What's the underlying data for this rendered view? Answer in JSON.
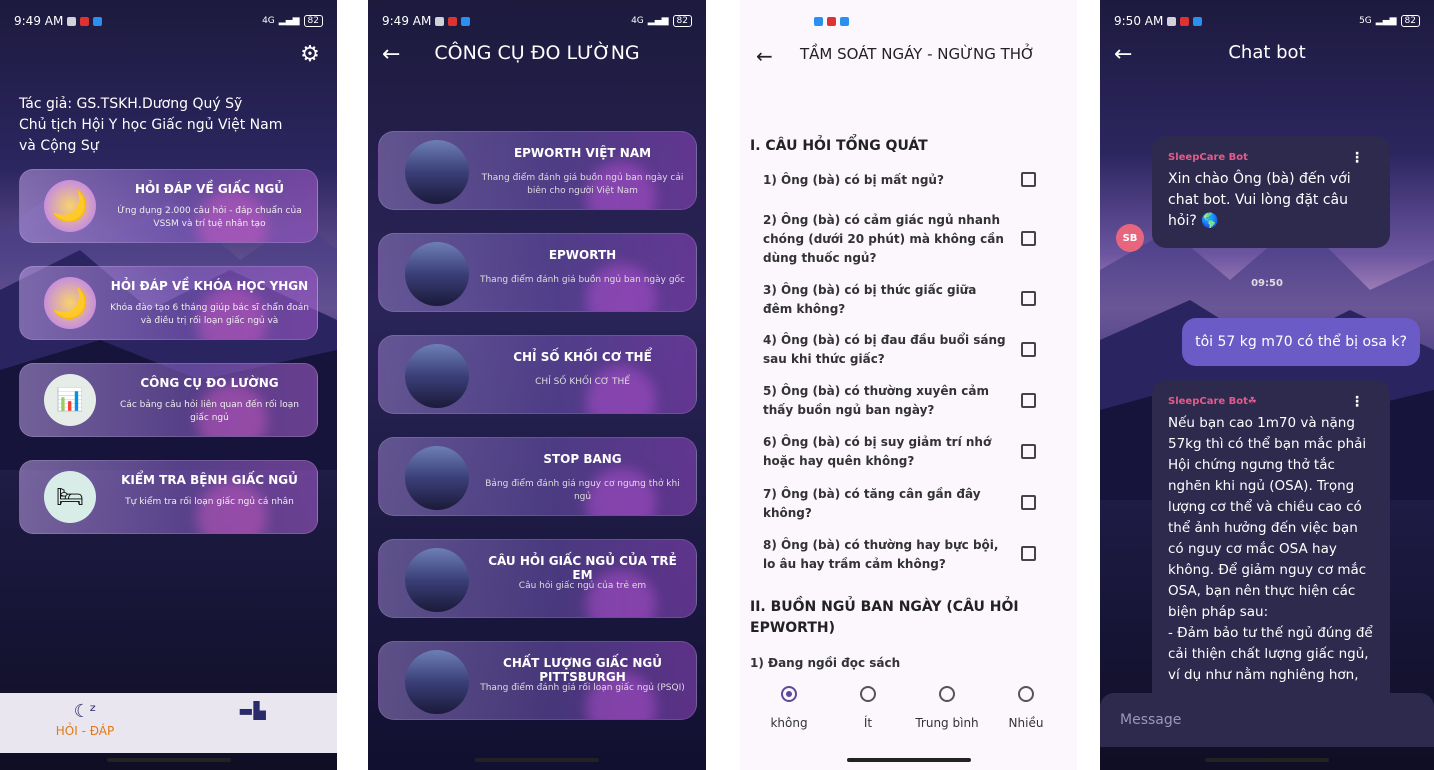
{
  "colors": {
    "bottom_nav_active": "#e07a18",
    "user_bubble": "#6b5bc6",
    "bot_bubble": "#2d2a4e",
    "bot_name": "#e45b8a",
    "avatar": "#e7667d"
  },
  "screen1": {
    "status": {
      "time": "9:49 AM",
      "signal": "4G",
      "battery": "82"
    },
    "settings_icon": "gear-icon",
    "author_lines": [
      "Tác giả: GS.TSKH.Dương Quý Sỹ",
      "Chủ tịch Hội Y học Giấc ngủ Việt Nam",
      "và Cộng Sự"
    ],
    "menu": [
      {
        "title": "HỎI ĐÁP VỀ GIẤC NGỦ",
        "subtitle": "Ứng dụng 2.000 câu hỏi - đáp chuẩn của VSSM và trí tuệ nhân tạo",
        "icon": "sleeping-moon-icon"
      },
      {
        "title": "HỎI ĐÁP VỀ KHÓA HỌC YHGN",
        "subtitle": "Khóa đào tạo 6 tháng giúp bác sĩ chẩn đoán và điều trị rối loạn giấc ngủ và",
        "icon": "sleeping-moon-icon"
      },
      {
        "title": "CÔNG CỤ ĐO LƯỜNG",
        "subtitle": "Các bảng câu hỏi liên quan đến rối loạn giấc ngủ",
        "icon": "measurement-tools-icon"
      },
      {
        "title": "KIỂM TRA BỆNH GIẤC NGỦ",
        "subtitle": "Tự kiểm tra rối loạn giấc ngủ cá nhân",
        "icon": "sleep-test-icon"
      }
    ],
    "nav": {
      "qa_label": "HỎI - ĐÁP",
      "qa_icon": "zzz-moon-icon",
      "bed_icon": "bed-icon"
    }
  },
  "screen2": {
    "status": {
      "time": "9:49 AM",
      "signal": "4G",
      "battery": "82"
    },
    "title": "CÔNG CỤ ĐO LƯỜNG",
    "tools": [
      {
        "title": "EPWORTH VIỆT NAM",
        "subtitle": "Thang điểm đánh giá buồn ngủ ban ngày cải biên cho người Việt Nam"
      },
      {
        "title": "EPWORTH",
        "subtitle": "Thang điểm đánh giá buồn ngủ ban ngày gốc"
      },
      {
        "title": "CHỈ SỐ KHỐI CƠ THỂ",
        "subtitle": "CHỈ SỐ KHỐI CƠ THỂ"
      },
      {
        "title": "STOP BANG",
        "subtitle": "Bảng điểm đánh giá nguy cơ ngưng thở khi ngủ"
      },
      {
        "title": "CÂU HỎI GIẤC NGỦ CỦA TRẺ EM",
        "subtitle": "Câu hỏi giấc ngủ của trẻ em"
      },
      {
        "title": "CHẤT LƯỢNG GIẤC NGỦ PITTSBURGH",
        "subtitle": "Thang điểm đánh giá rối loạn giấc ngủ (PSQI)"
      }
    ]
  },
  "screen3": {
    "title": "TẦM SOÁT NGÁY - NGỪNG THỞ",
    "section1": "I. CÂU HỎI TỔNG QUÁT",
    "questions": [
      "1) Ông (bà) có bị mất ngủ?",
      "2) Ông (bà) có cảm giác ngủ nhanh chóng (dưới 20 phút) mà không cần dùng thuốc ngủ?",
      "3) Ông (bà) có bị thức giấc giữa đêm không?",
      "4) Ông (bà) có bị đau đầu buổi sáng sau khi thức giấc?",
      "5) Ông (bà) có thường xuyên cảm thấy buồn ngủ ban ngày?",
      "6) Ông (bà) có bị suy giảm trí nhớ hoặc hay quên không?",
      "7) Ông (bà) có tăng cân gần đây không?",
      "8) Ông (bà) có thường hay bực bội, lo âu hay trầm cảm không?"
    ],
    "section2": "II. BUỒN NGỦ BAN NGÀY (CÂU HỎI EPWORTH)",
    "epworth_q1": "1) Đang ngồi đọc sách",
    "options": [
      "không",
      "Ít",
      "Trung bình",
      "Nhiều"
    ],
    "selected_option": "không"
  },
  "screen4": {
    "status": {
      "time": "9:50 AM",
      "signal": "5G",
      "battery": "82"
    },
    "title": "Chat bot",
    "bot_name_1": "SleepCare Bot",
    "bot_msg_1": "Xin chào Ông (bà) đến với chat bot. Vui lòng đặt câu hỏi? 🌎",
    "avatar": "SB",
    "time": "09:50",
    "user_msg": "tôi 57 kg m70 có thể bị osa k?",
    "bot_name_2": "SleepCare Bot☘",
    "bot_msg_2_lines": [
      "Nếu bạn cao 1m70 và nặng",
      "57kg thì có thể bạn mắc phải",
      "Hội chứng ngưng thở tắc",
      "nghẽn khi ngủ (OSA). Trọng",
      "lượng cơ thể và chiều cao có",
      "thể ảnh hưởng đến việc bạn",
      "có nguy cơ mắc OSA hay",
      "không. Để giảm nguy cơ mắc",
      "OSA, bạn nên thực hiện các",
      "biện pháp sau:",
      "- Đảm bảo tư thế ngủ đúng để",
      "cải thiện chất lượng giấc ngủ,",
      "ví dụ như nằm nghiêng hơn,"
    ],
    "input_placeholder": "Message"
  }
}
